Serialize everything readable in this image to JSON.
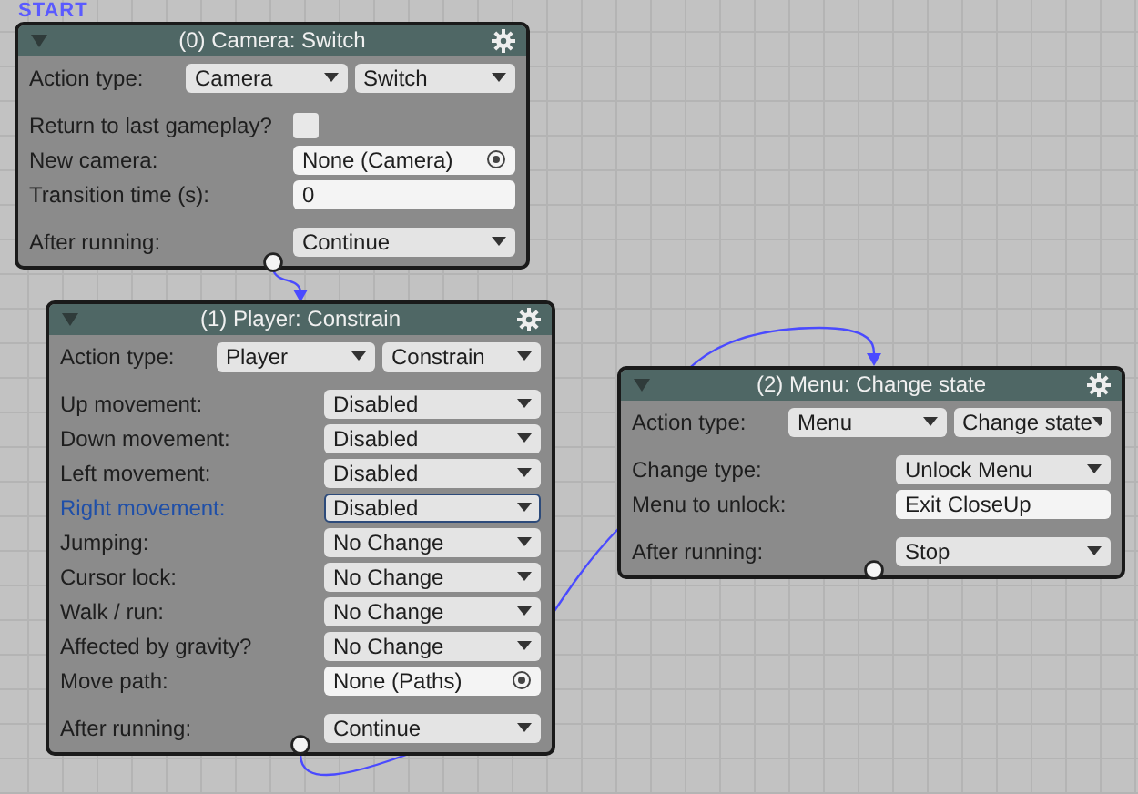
{
  "start_label": "START",
  "nodes": [
    {
      "title": "(0) Camera: Switch",
      "action_type": {
        "label": "Action type:",
        "values": [
          "Camera",
          "Switch"
        ]
      },
      "fields": [
        {
          "kind": "checkbox",
          "label": "Return to last gameplay?",
          "checked": false,
          "focused": false
        },
        {
          "kind": "object",
          "label": "New camera:",
          "value": "None (Camera)",
          "focused": false
        },
        {
          "kind": "text",
          "label": "Transition time (s):",
          "value": "0",
          "focused": false
        }
      ],
      "after_running": {
        "label": "After running:",
        "value": "Continue"
      }
    },
    {
      "title": "(1) Player: Constrain",
      "action_type": {
        "label": "Action type:",
        "values": [
          "Player",
          "Constrain"
        ]
      },
      "fields": [
        {
          "kind": "dropdown",
          "label": "Up movement:",
          "value": "Disabled",
          "focused": false
        },
        {
          "kind": "dropdown",
          "label": "Down movement:",
          "value": "Disabled",
          "focused": false
        },
        {
          "kind": "dropdown",
          "label": "Left movement:",
          "value": "Disabled",
          "focused": false
        },
        {
          "kind": "dropdown",
          "label": "Right movement:",
          "value": "Disabled",
          "focused": true
        },
        {
          "kind": "dropdown",
          "label": "Jumping:",
          "value": "No Change",
          "focused": false
        },
        {
          "kind": "dropdown",
          "label": "Cursor lock:",
          "value": "No Change",
          "focused": false
        },
        {
          "kind": "dropdown",
          "label": "Walk / run:",
          "value": "No Change",
          "focused": false
        },
        {
          "kind": "dropdown",
          "label": "Affected by gravity?",
          "value": "No Change",
          "focused": false
        },
        {
          "kind": "object",
          "label": "Move path:",
          "value": "None (Paths)",
          "focused": false
        }
      ],
      "after_running": {
        "label": "After running:",
        "value": "Continue"
      }
    },
    {
      "title": "(2) Menu: Change state",
      "action_type": {
        "label": "Action type:",
        "values": [
          "Menu",
          "Change state"
        ]
      },
      "fields": [
        {
          "kind": "dropdown",
          "label": "Change type:",
          "value": "Unlock Menu",
          "focused": false
        },
        {
          "kind": "text",
          "label": "Menu to unlock:",
          "value": "Exit CloseUp",
          "focused": false
        }
      ],
      "after_running": {
        "label": "After running:",
        "value": "Stop"
      }
    }
  ]
}
